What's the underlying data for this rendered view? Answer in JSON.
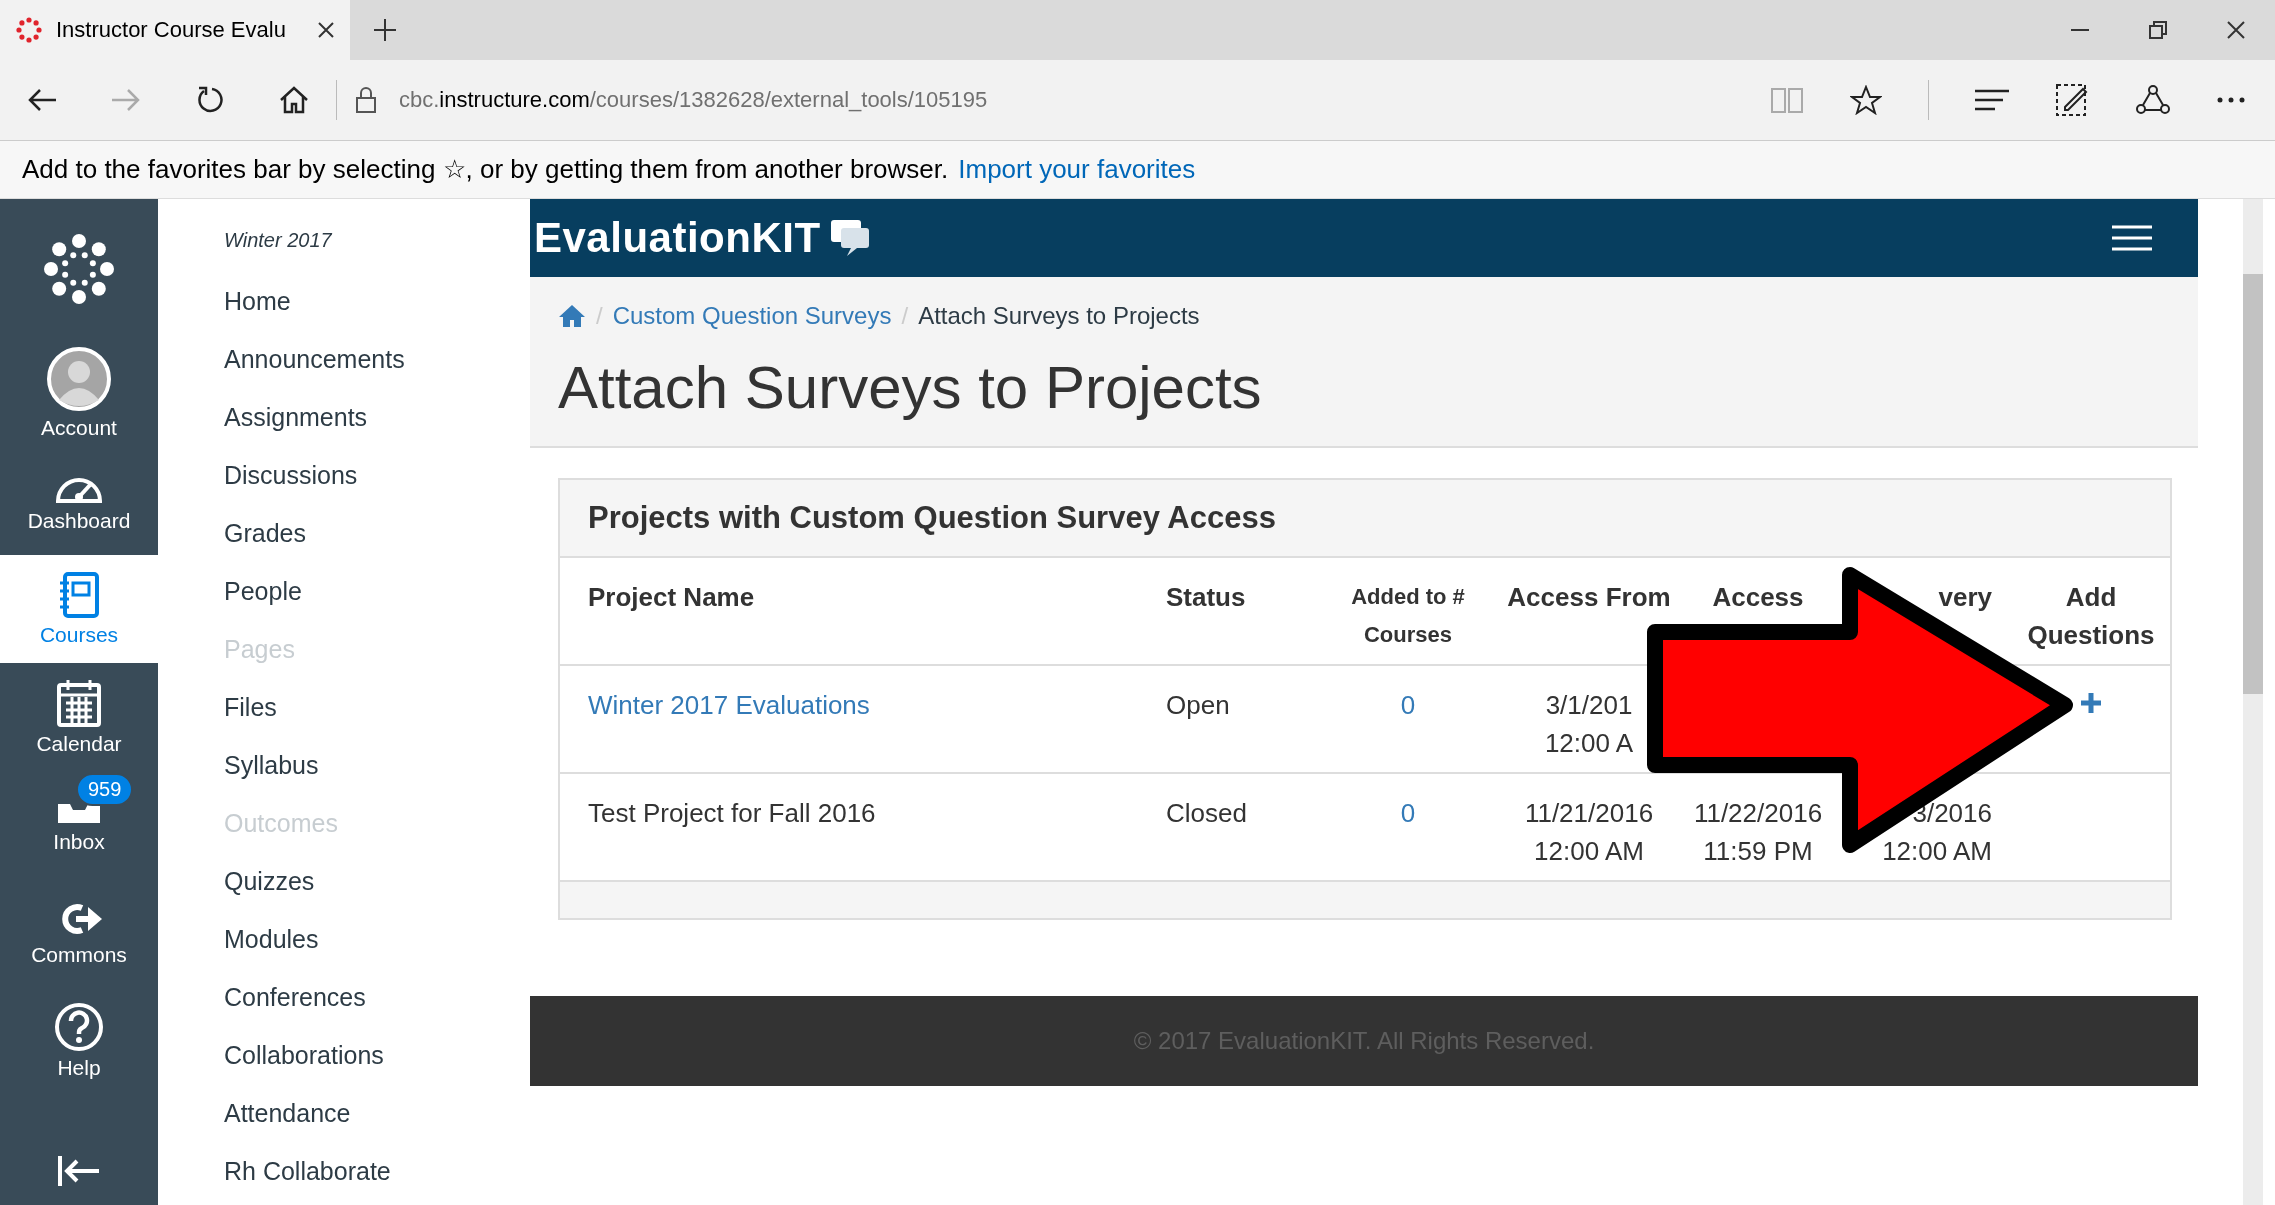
{
  "browser": {
    "tab_title": "Instructor Course Evalu",
    "url": {
      "prefix": "cbc.",
      "host": "instructure.com",
      "path": "/courses/1382628/external_tools/105195"
    },
    "favorites_message": "Add to the favorites bar by selecting ☆, or by getting them from another browser.",
    "favorites_link": "Import your favorites"
  },
  "global_nav": [
    {
      "kind": "account",
      "label": "Account",
      "selected": false
    },
    {
      "kind": "dashboard",
      "label": "Dashboard",
      "selected": false
    },
    {
      "kind": "courses",
      "label": "Courses",
      "selected": true
    },
    {
      "kind": "calendar",
      "label": "Calendar",
      "selected": false
    },
    {
      "kind": "inbox",
      "label": "Inbox",
      "selected": false,
      "badge": "959"
    },
    {
      "kind": "commons",
      "label": "Commons",
      "selected": false
    },
    {
      "kind": "help",
      "label": "Help",
      "selected": false
    }
  ],
  "course_nav": {
    "term": "Winter 2017",
    "items": [
      {
        "label": "Home",
        "disabled": false
      },
      {
        "label": "Announcements",
        "disabled": false
      },
      {
        "label": "Assignments",
        "disabled": false
      },
      {
        "label": "Discussions",
        "disabled": false
      },
      {
        "label": "Grades",
        "disabled": false
      },
      {
        "label": "People",
        "disabled": false
      },
      {
        "label": "Pages",
        "disabled": true
      },
      {
        "label": "Files",
        "disabled": false
      },
      {
        "label": "Syllabus",
        "disabled": false
      },
      {
        "label": "Outcomes",
        "disabled": true
      },
      {
        "label": "Quizzes",
        "disabled": false
      },
      {
        "label": "Modules",
        "disabled": false
      },
      {
        "label": "Conferences",
        "disabled": false
      },
      {
        "label": "Collaborations",
        "disabled": false
      },
      {
        "label": "Attendance",
        "disabled": false
      },
      {
        "label": "Rh Collaborate",
        "disabled": false
      }
    ]
  },
  "app": {
    "brand": "EvaluationKIT",
    "breadcrumb_separator": "/",
    "breadcrumb": [
      "Custom Question Surveys",
      "Attach Surveys to Projects"
    ],
    "title": "Attach Surveys to Projects",
    "panel": {
      "title": "Projects with Custom Question Survey Access",
      "columns": [
        "Project Name",
        "Status",
        "Added to # Courses",
        "Access From",
        "Access",
        "very",
        "Add Questions"
      ],
      "rows": [
        {
          "name": "Winter 2017 Evaluations",
          "name_is_link": true,
          "status": "Open",
          "added": "0",
          "access_from": [
            "3/1/201",
            "12:00 A"
          ],
          "access_until": [],
          "column_6": [],
          "add_question": true
        },
        {
          "name": "Test Project for Fall 2016",
          "name_is_link": false,
          "status": "Closed",
          "added": "0",
          "access_from": [
            "11/21/2016",
            "12:00 AM"
          ],
          "access_until": [
            "11/22/2016",
            "11:59 PM"
          ],
          "column_6": [
            "3/2016",
            "12:00 AM"
          ],
          "add_question": false
        }
      ]
    },
    "footer": "© 2017 EvaluationKIT. All Rights Reserved."
  }
}
